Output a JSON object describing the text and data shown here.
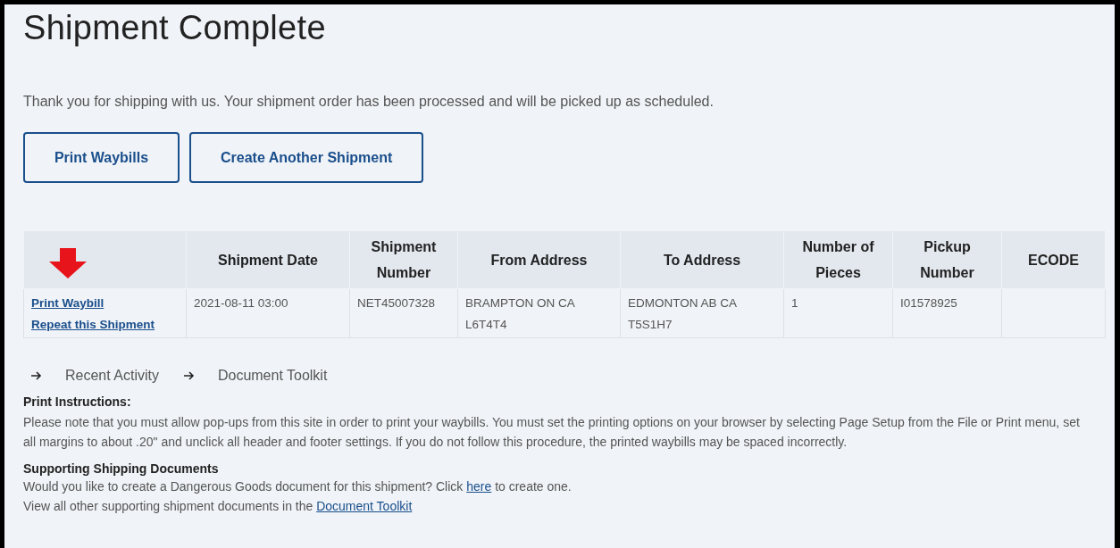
{
  "title": "Shipment Complete",
  "message": "Thank you for shipping with us. Your shipment order has been processed and will be picked up as scheduled.",
  "buttons": [
    "Print Waybills",
    "Create Another Shipment"
  ],
  "table": {
    "columns": [
      "Shipment Date",
      "Shipment Number",
      "From Address",
      "To Address",
      "Number of Pieces",
      "Pickup Number",
      "ECODE"
    ],
    "rows": [
      {
        "links": [
          "Print Waybill",
          "Repeat this Shipment"
        ],
        "cells": [
          "2021-08-11 03:00",
          "NET45007328",
          "BRAMPTON ON CA L6T4T4",
          "EDMONTON AB CA T5S1H7",
          "1",
          "I01578925"
        ]
      }
    ]
  },
  "quick_links": [
    "Recent Activity",
    "Document Toolkit"
  ],
  "print_instructions": {
    "heading": "Print Instructions:",
    "text": "Please note that you must allow pop-ups from this site in order to print your waybills. You must set the printing options on your browser by selecting Page Setup from the File or Print menu, set all margins to about .20\" and unclick all header and footer settings. If you do not follow this procedure, the printed waybills may be spaced incorrectly."
  },
  "supporting": {
    "heading": "Supporting Shipping Documents",
    "lines": [
      {
        "before": "Would you like to create a Dangerous Goods document for this shipment? Click ",
        "link": "here",
        "after": " to create one."
      },
      {
        "before": "View all other supporting shipment documents in the ",
        "link": "Document Toolkit"
      }
    ]
  }
}
